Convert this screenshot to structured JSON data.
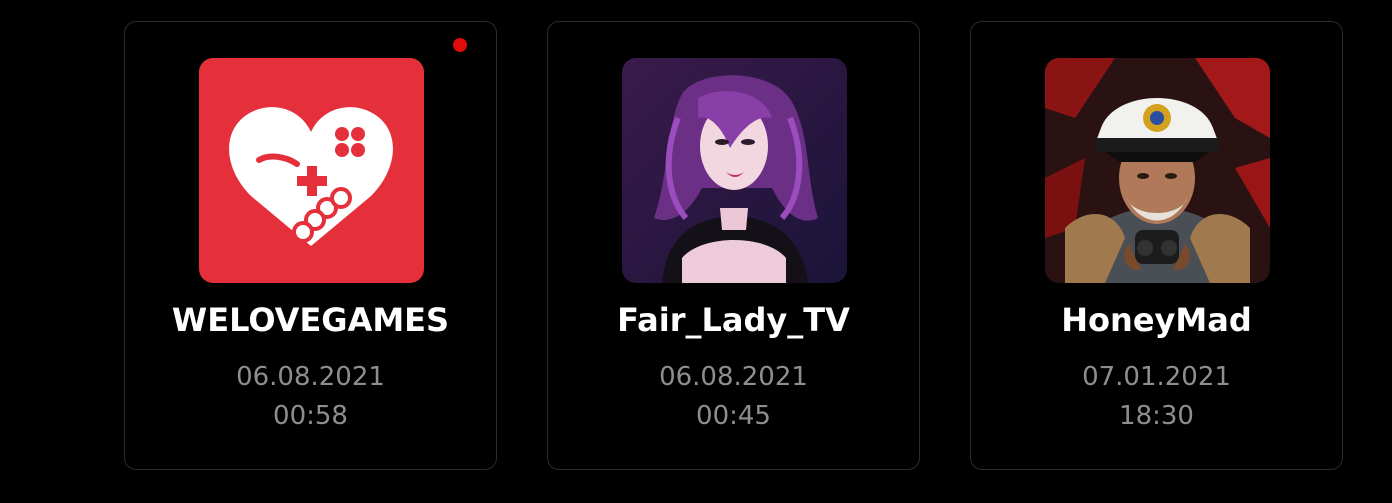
{
  "colors": {
    "background": "#000000",
    "card_border": "#2b2b2b",
    "name_text": "#ffffff",
    "meta_text": "#8e8e8e",
    "live_indicator": "#e00b0b",
    "welovegames_brand": "#e5303b"
  },
  "streamers": [
    {
      "name": "WELOVEGAMES",
      "date": "06.08.2021",
      "time": "00:58",
      "avatar_icon": "heart-gamepad-logo-icon",
      "live": true
    },
    {
      "name": "Fair_Lady_TV",
      "date": "06.08.2021",
      "time": "00:45",
      "avatar_icon": "woman-portrait-avatar",
      "live": false
    },
    {
      "name": "HoneyMad",
      "date": "07.01.2021",
      "time": "18:30",
      "avatar_icon": "naval-captain-portrait-avatar",
      "live": false
    }
  ]
}
